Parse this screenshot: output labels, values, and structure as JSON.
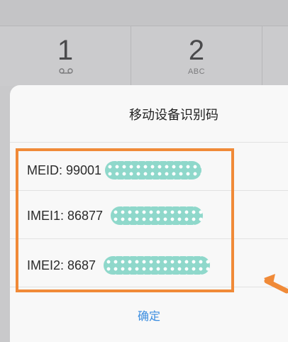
{
  "keypad": {
    "keys": [
      {
        "digit": "1",
        "sub": "",
        "icon": "voicemail-icon"
      },
      {
        "digit": "2",
        "sub": "ABC"
      }
    ]
  },
  "dialog": {
    "title": "移动设备识别码",
    "rows": [
      {
        "label": "MEID: 99001"
      },
      {
        "label": "IMEI1: 86877"
      },
      {
        "label": "IMEI2: 8687"
      }
    ],
    "confirm_label": "确定"
  },
  "annotation": {
    "highlight_color": "#f08a38",
    "redaction_color": "#8fd8cb"
  }
}
